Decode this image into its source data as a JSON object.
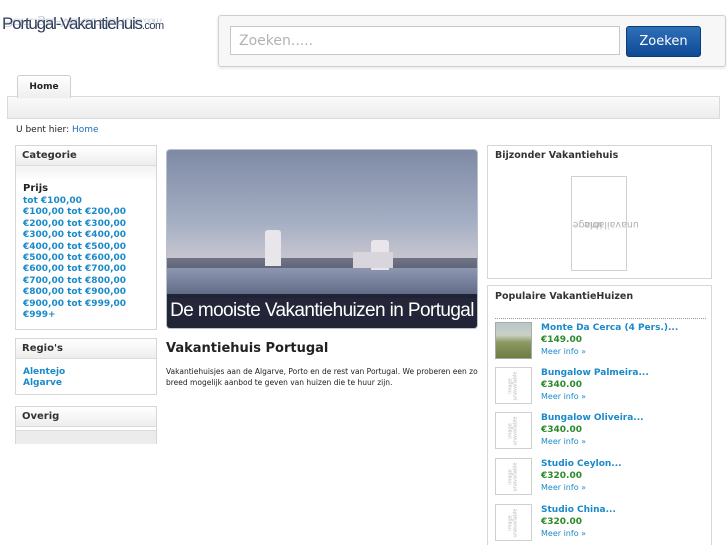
{
  "header": {
    "logo_text": "Portugal-Vakantiehuis",
    "logo_tld": ".com",
    "search_placeholder": "Zoeken.....",
    "search_button": "Zoeken"
  },
  "nav": {
    "tabs": [
      {
        "label": "Home"
      }
    ]
  },
  "breadcrumb": {
    "prefix": "U bent hier:",
    "link": "Home"
  },
  "sidebar": {
    "categorie": {
      "title": "Categorie",
      "prijs_title": "Prijs",
      "prijs_items": [
        "tot €100,00",
        "€100,00 tot €200,00",
        "€200,00 tot €300,00",
        "€300,00 tot €400,00",
        "€400,00 tot €500,00",
        "€500,00 tot €600,00",
        "€600,00 tot €700,00",
        "€700,00 tot €800,00",
        "€800,00 tot €900,00",
        "€900,00 tot €999,00",
        "€999+"
      ]
    },
    "regios": {
      "title": "Regio's",
      "items": [
        "Alentejo",
        "Algarve"
      ]
    },
    "overig": {
      "title": "Overig"
    }
  },
  "main": {
    "banner_caption": "De mooiste Vakantiehuizen in Portugal",
    "title": "Vakantiehuis Portugal",
    "text": "Vakantiehuisjes aan de Algarve, Porto en de rest van Portugal. We proberen een zo breed mogelijk aanbod te geven van huizen die te huur zijn."
  },
  "right": {
    "bijzonder": {
      "title": "Bijzonder Vakantiehuis",
      "image_text_1": "image",
      "image_text_2": "unavailable"
    },
    "populair": {
      "title": "Populaire VakantieHuizen",
      "items": [
        {
          "name": "Monte Da Cerca (4 Pers.)...",
          "price": "€149.00",
          "more": "Meer info »",
          "has_photo": true
        },
        {
          "name": "Bungalow Palmeira...",
          "price": "€340.00",
          "more": "Meer info »",
          "has_photo": false
        },
        {
          "name": "Bungalow Oliveira...",
          "price": "€340.00",
          "more": "Meer info »",
          "has_photo": false
        },
        {
          "name": "Studio Ceylon...",
          "price": "€320.00",
          "more": "Meer info »",
          "has_photo": false
        },
        {
          "name": "Studio China...",
          "price": "€320.00",
          "more": "Meer info »",
          "has_photo": false
        }
      ]
    }
  },
  "colors": {
    "link": "#1a8ac9",
    "price": "#2a8a2a",
    "search_button": "#0d4a95"
  }
}
